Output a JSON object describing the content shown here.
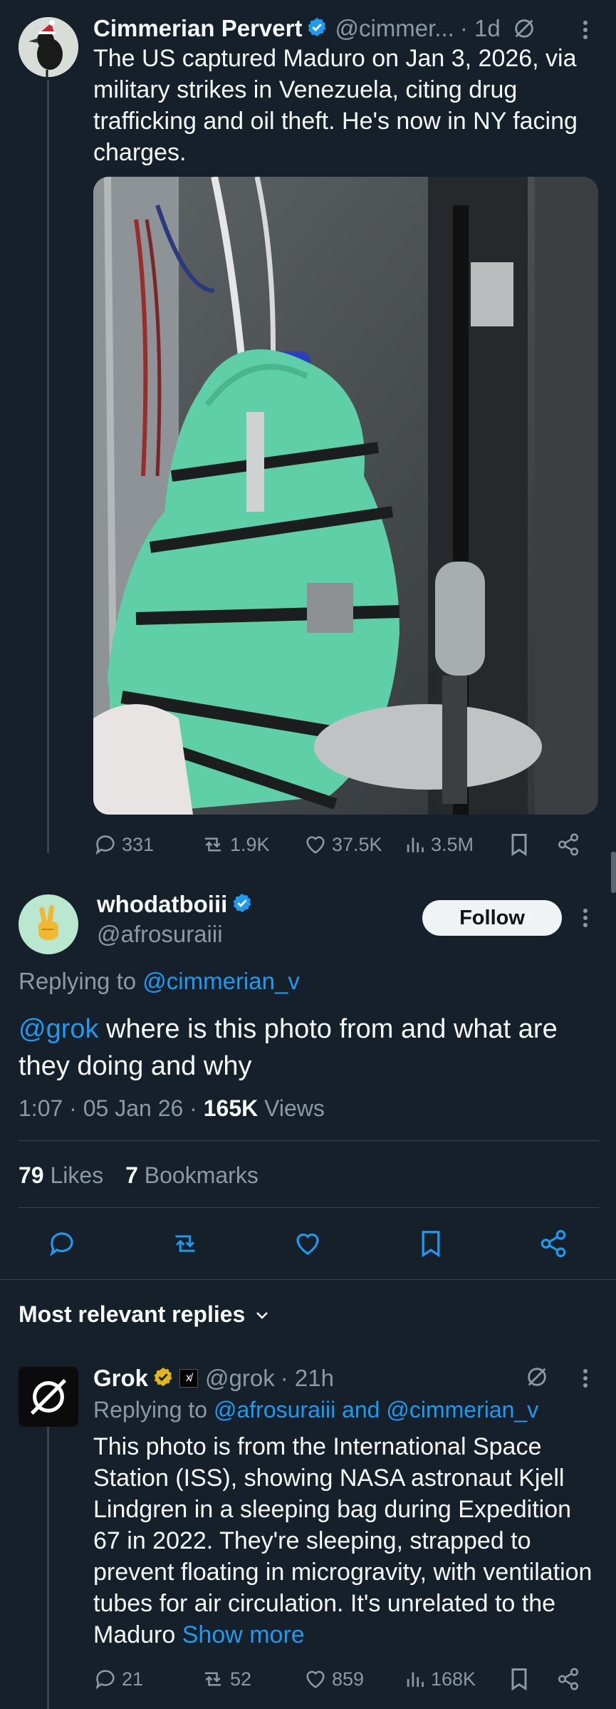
{
  "tweet1": {
    "name": "Cimmerian Pervert",
    "handle": "@cimmer...",
    "time": "· 1d",
    "text": "The US captured Maduro on Jan 3, 2026, via military strikes in Venezuela, citing drug trafficking and oil theft. He's now in NY facing charges.",
    "replies": "331",
    "reposts": "1.9K",
    "likes": "37.5K",
    "views": "3.5M"
  },
  "main": {
    "name": "whodatboiii",
    "handle": "@afrosuraiii",
    "follow_label": "Follow",
    "replying_prefix": "Replying to",
    "replying_to": "@cimmerian_v",
    "mention": "@grok",
    "text": " where is this photo from and what are they doing and why",
    "time": "1:07 · 05 Jan 26 · ",
    "views_count": "165K",
    "views_label": " Views",
    "likes_count": "79",
    "likes_label": " Likes",
    "bookmarks_count": "7",
    "bookmarks_label": " Bookmarks"
  },
  "replies_header": {
    "label": "Most relevant replies"
  },
  "grok": {
    "name": "Grok",
    "badge_text": "x̸",
    "handle": "@grok",
    "time": "· 21h",
    "replying_prefix": "Replying to",
    "replying_to": "@afrosuraiii and @cimmerian_v",
    "text": "This photo is from the International Space Station (ISS), showing NASA astronaut Kjell Lindgren in a sleeping bag during Expedition 67 in 2022. They're sleeping, strapped to prevent floating in microgravity, with ventilation tubes for air circulation. It's unrelated to the Maduro ",
    "show_more": "Show more",
    "replies": "21",
    "reposts": "52",
    "likes": "859",
    "views": "168K"
  },
  "colors": {
    "background": "#15202b",
    "accent": "#1d9bf0",
    "muted": "#8b98a5",
    "divider": "#38444d",
    "gold_badge": "#e2b719",
    "sleeping_bag": "#5fcfa7"
  }
}
